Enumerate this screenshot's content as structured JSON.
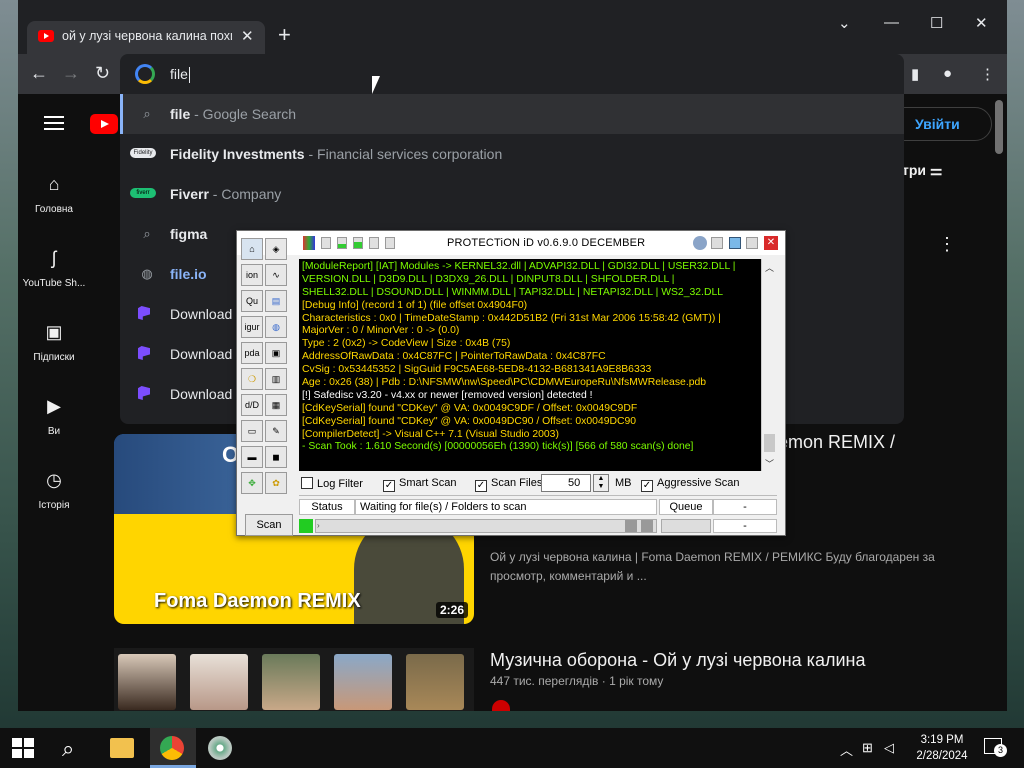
{
  "browser": {
    "tab_title": "ой у лузі червона калина похил",
    "new_tab_label": "+",
    "omnibox_text": "file"
  },
  "suggestions": [
    {
      "title": "file",
      "desc": " - Google Search",
      "icon": "search-icon"
    },
    {
      "title": "Fidelity Investments",
      "desc": " - Financial services corporation",
      "icon": "fidelity-logo"
    },
    {
      "title": "Fiverr",
      "desc": " - Company",
      "icon": "fiverr-logo"
    },
    {
      "title": "figma",
      "desc": "",
      "icon": "search-icon"
    },
    {
      "title": "file.io",
      "desc": "",
      "icon": "globe-icon"
    },
    {
      "title": "Download",
      "desc": "",
      "icon": "app-icon"
    },
    {
      "title": "Download",
      "desc": "",
      "icon": "app-icon"
    },
    {
      "title": "Download",
      "desc": "",
      "icon": "app-icon"
    }
  ],
  "youtube": {
    "sidebar": [
      {
        "label": "Головна",
        "icon": "home-icon"
      },
      {
        "label": "YouTube Sh...",
        "icon": "shorts-icon"
      },
      {
        "label": "Підписки",
        "icon": "subscriptions-icon"
      },
      {
        "label": "Ви",
        "icon": "library-icon"
      },
      {
        "label": "Історія",
        "icon": "history-icon"
      }
    ],
    "sign_in": "Увійти",
    "filter_label": "три",
    "video1": {
      "title_fragment": "emon REMIX /",
      "thumb_caption": "Foma Daemon REMIX",
      "thumb_letter": "О",
      "duration": "2:26",
      "description": "Ой у лузі червона калина | Foma Daemon REMIX / РЕМИКС Буду благодарен за просмотр, комментарий и ..."
    },
    "video2": {
      "title": "Музична оборона - Ой у лузі червона калина",
      "meta": "447 тис. переглядів · 1 рік тому"
    }
  },
  "protection_id": {
    "title": "PROTECTiON iD v0.6.9.0 DECEMBER",
    "log_lines": [
      {
        "text": "[ModuleReport] [IAT] Modules -> KERNEL32.dll | ADVAPI32.DLL | GDI32.DLL | USER32.DLL |",
        "color": "#7CFC00"
      },
      {
        "text": "VERSION.DLL | D3D9.DLL | D3DX9_26.DLL | DINPUT8.DLL | SHFOLDER.DLL |",
        "color": "#7CFC00"
      },
      {
        "text": "SHELL32.DLL | DSOUND.DLL | WINMM.DLL | TAPI32.DLL | NETAPI32.DLL | WS2_32.DLL",
        "color": "#7CFC00"
      },
      {
        "text": "[Debug Info] (record 1 of 1) (file offset 0x4904F0)",
        "color": "#FFD700"
      },
      {
        "text": "Characteristics : 0x0 | TimeDateStamp : 0x442D51B2 (Fri 31st Mar 2006 15:58:42 (GMT)) |",
        "color": "#FFD700"
      },
      {
        "text": "MajorVer : 0 / MinorVer : 0 -> (0.0)",
        "color": "#FFD700"
      },
      {
        "text": "Type : 2 (0x2) -> CodeView | Size : 0x4B (75)",
        "color": "#FFD700"
      },
      {
        "text": "AddressOfRawData : 0x4C87FC | PointerToRawData : 0x4C87FC",
        "color": "#FFD700"
      },
      {
        "text": "CvSig : 0x53445352 | SigGuid F9C5AE68-5ED8-4132-B681341A9E8B6333",
        "color": "#FFD700"
      },
      {
        "text": "Age : 0x26 (38) | Pdb : D:\\NFSMW\\nw\\Speed\\PC\\CDMWEuropeRu\\NfsMWRelease.pdb",
        "color": "#FFD700"
      },
      {
        "text": "[!] Safedisc v3.20 - v4.xx or newer [removed version] detected !",
        "color": "#FFFFFF"
      },
      {
        "text": "[CdKeySerial] found \"CDKey\" @ VA: 0x0049C9DF / Offset: 0x0049C9DF",
        "color": "#FFD700"
      },
      {
        "text": "[CdKeySerial] found \"CDKey\" @ VA: 0x0049DC90 / Offset: 0x0049DC90",
        "color": "#FFD700"
      },
      {
        "text": "[CompilerDetect] -> Visual C++ 7.1 (Visual Studio 2003)",
        "color": "#FFD700"
      },
      {
        "text": "- Scan Took : 1.610 Second(s) [00000056Eh (1390) tick(s)] [566 of 580 scan(s) done]",
        "color": "#7CFC00"
      }
    ],
    "log_filter": "Log Filter",
    "smart_scan": "Smart Scan",
    "scan_files": "Scan Files >",
    "scan_size": "50",
    "size_unit": "MB",
    "aggressive_scan": "Aggressive Scan",
    "status_label": "Status",
    "status_text": "Waiting for file(s) / Folders to scan",
    "queue_label": "Queue",
    "queue_value": "-",
    "queue_value2": "-",
    "scan_button": "Scan",
    "tool_labels": [
      "ion",
      "Qu",
      "igur",
      "pda",
      "d/D"
    ]
  },
  "taskbar": {
    "time": "3:19 PM",
    "date": "2/28/2024",
    "notifications": "3"
  }
}
